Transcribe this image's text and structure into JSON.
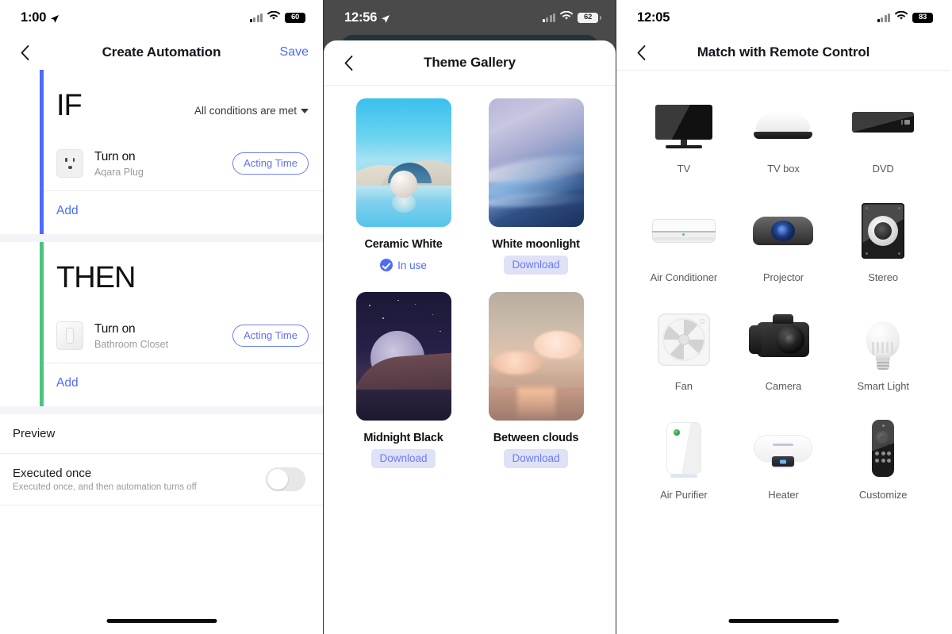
{
  "panel_automation": {
    "status_bar": {
      "time": "1:00",
      "location_icon": "location-arrow-icon",
      "battery": "60"
    },
    "nav": {
      "back_icon": "chevron-left-icon",
      "title": "Create Automation",
      "action": "Save"
    },
    "if_section": {
      "keyword": "IF",
      "condition_selector": "All conditions are met",
      "chevron_icon": "caret-down-icon",
      "devices": [
        {
          "icon": "smart-plug-icon",
          "action": "Turn on",
          "device": "Aqara Plug",
          "pill": "Acting Time"
        }
      ],
      "add_label": "Add"
    },
    "then_section": {
      "keyword": "THEN",
      "devices": [
        {
          "icon": "light-switch-icon",
          "action": "Turn on",
          "device": "Bathroom Closet",
          "pill": "Acting Time"
        }
      ],
      "add_label": "Add"
    },
    "options": [
      {
        "label": "Preview",
        "sub": "",
        "has_toggle": false
      },
      {
        "label": "Executed once",
        "sub": "Executed once, and then automation turns off",
        "has_toggle": true,
        "toggle_on": false
      }
    ]
  },
  "panel_theme": {
    "status_bar": {
      "time": "12:56",
      "location_icon": "location-arrow-icon",
      "battery": "62"
    },
    "nav": {
      "back_icon": "chevron-left-icon",
      "title": "Theme Gallery"
    },
    "themes": [
      {
        "name": "Ceramic White",
        "action": "In use",
        "state": "in-use",
        "art": "th-ceramic"
      },
      {
        "name": "White moonlight",
        "action": "Download",
        "state": "download",
        "art": "th-moonlight"
      },
      {
        "name": "Midnight Black",
        "action": "Download",
        "state": "download",
        "art": "th-midnight"
      },
      {
        "name": "Between clouds",
        "action": "Download",
        "state": "download",
        "art": "th-clouds"
      }
    ]
  },
  "panel_remote": {
    "status_bar": {
      "time": "12:05",
      "battery": "83"
    },
    "nav": {
      "back_icon": "chevron-left-icon",
      "title": "Match with Remote Control"
    },
    "devices": [
      {
        "label": "TV",
        "icon": "tv-icon"
      },
      {
        "label": "TV box",
        "icon": "tv-box-icon"
      },
      {
        "label": "DVD",
        "icon": "dvd-player-icon"
      },
      {
        "label": "Air Conditioner",
        "icon": "air-conditioner-icon"
      },
      {
        "label": "Projector",
        "icon": "projector-icon"
      },
      {
        "label": "Stereo",
        "icon": "stereo-speaker-icon"
      },
      {
        "label": "Fan",
        "icon": "fan-icon"
      },
      {
        "label": "Camera",
        "icon": "camera-icon"
      },
      {
        "label": "Smart Light",
        "icon": "light-bulb-icon"
      },
      {
        "label": "Air Purifier",
        "icon": "air-purifier-icon"
      },
      {
        "label": "Heater",
        "icon": "water-heater-icon"
      },
      {
        "label": "Customize",
        "icon": "remote-control-icon"
      }
    ]
  },
  "colors": {
    "accent_blue": "#4d6bfb",
    "pill_blue": "#5e70f7",
    "rail_if": "#4d6bfb",
    "rail_then": "#4ac47f",
    "download_badge_bg": "#dfe2f6",
    "status_dark_bg": "#4a4a4a"
  }
}
